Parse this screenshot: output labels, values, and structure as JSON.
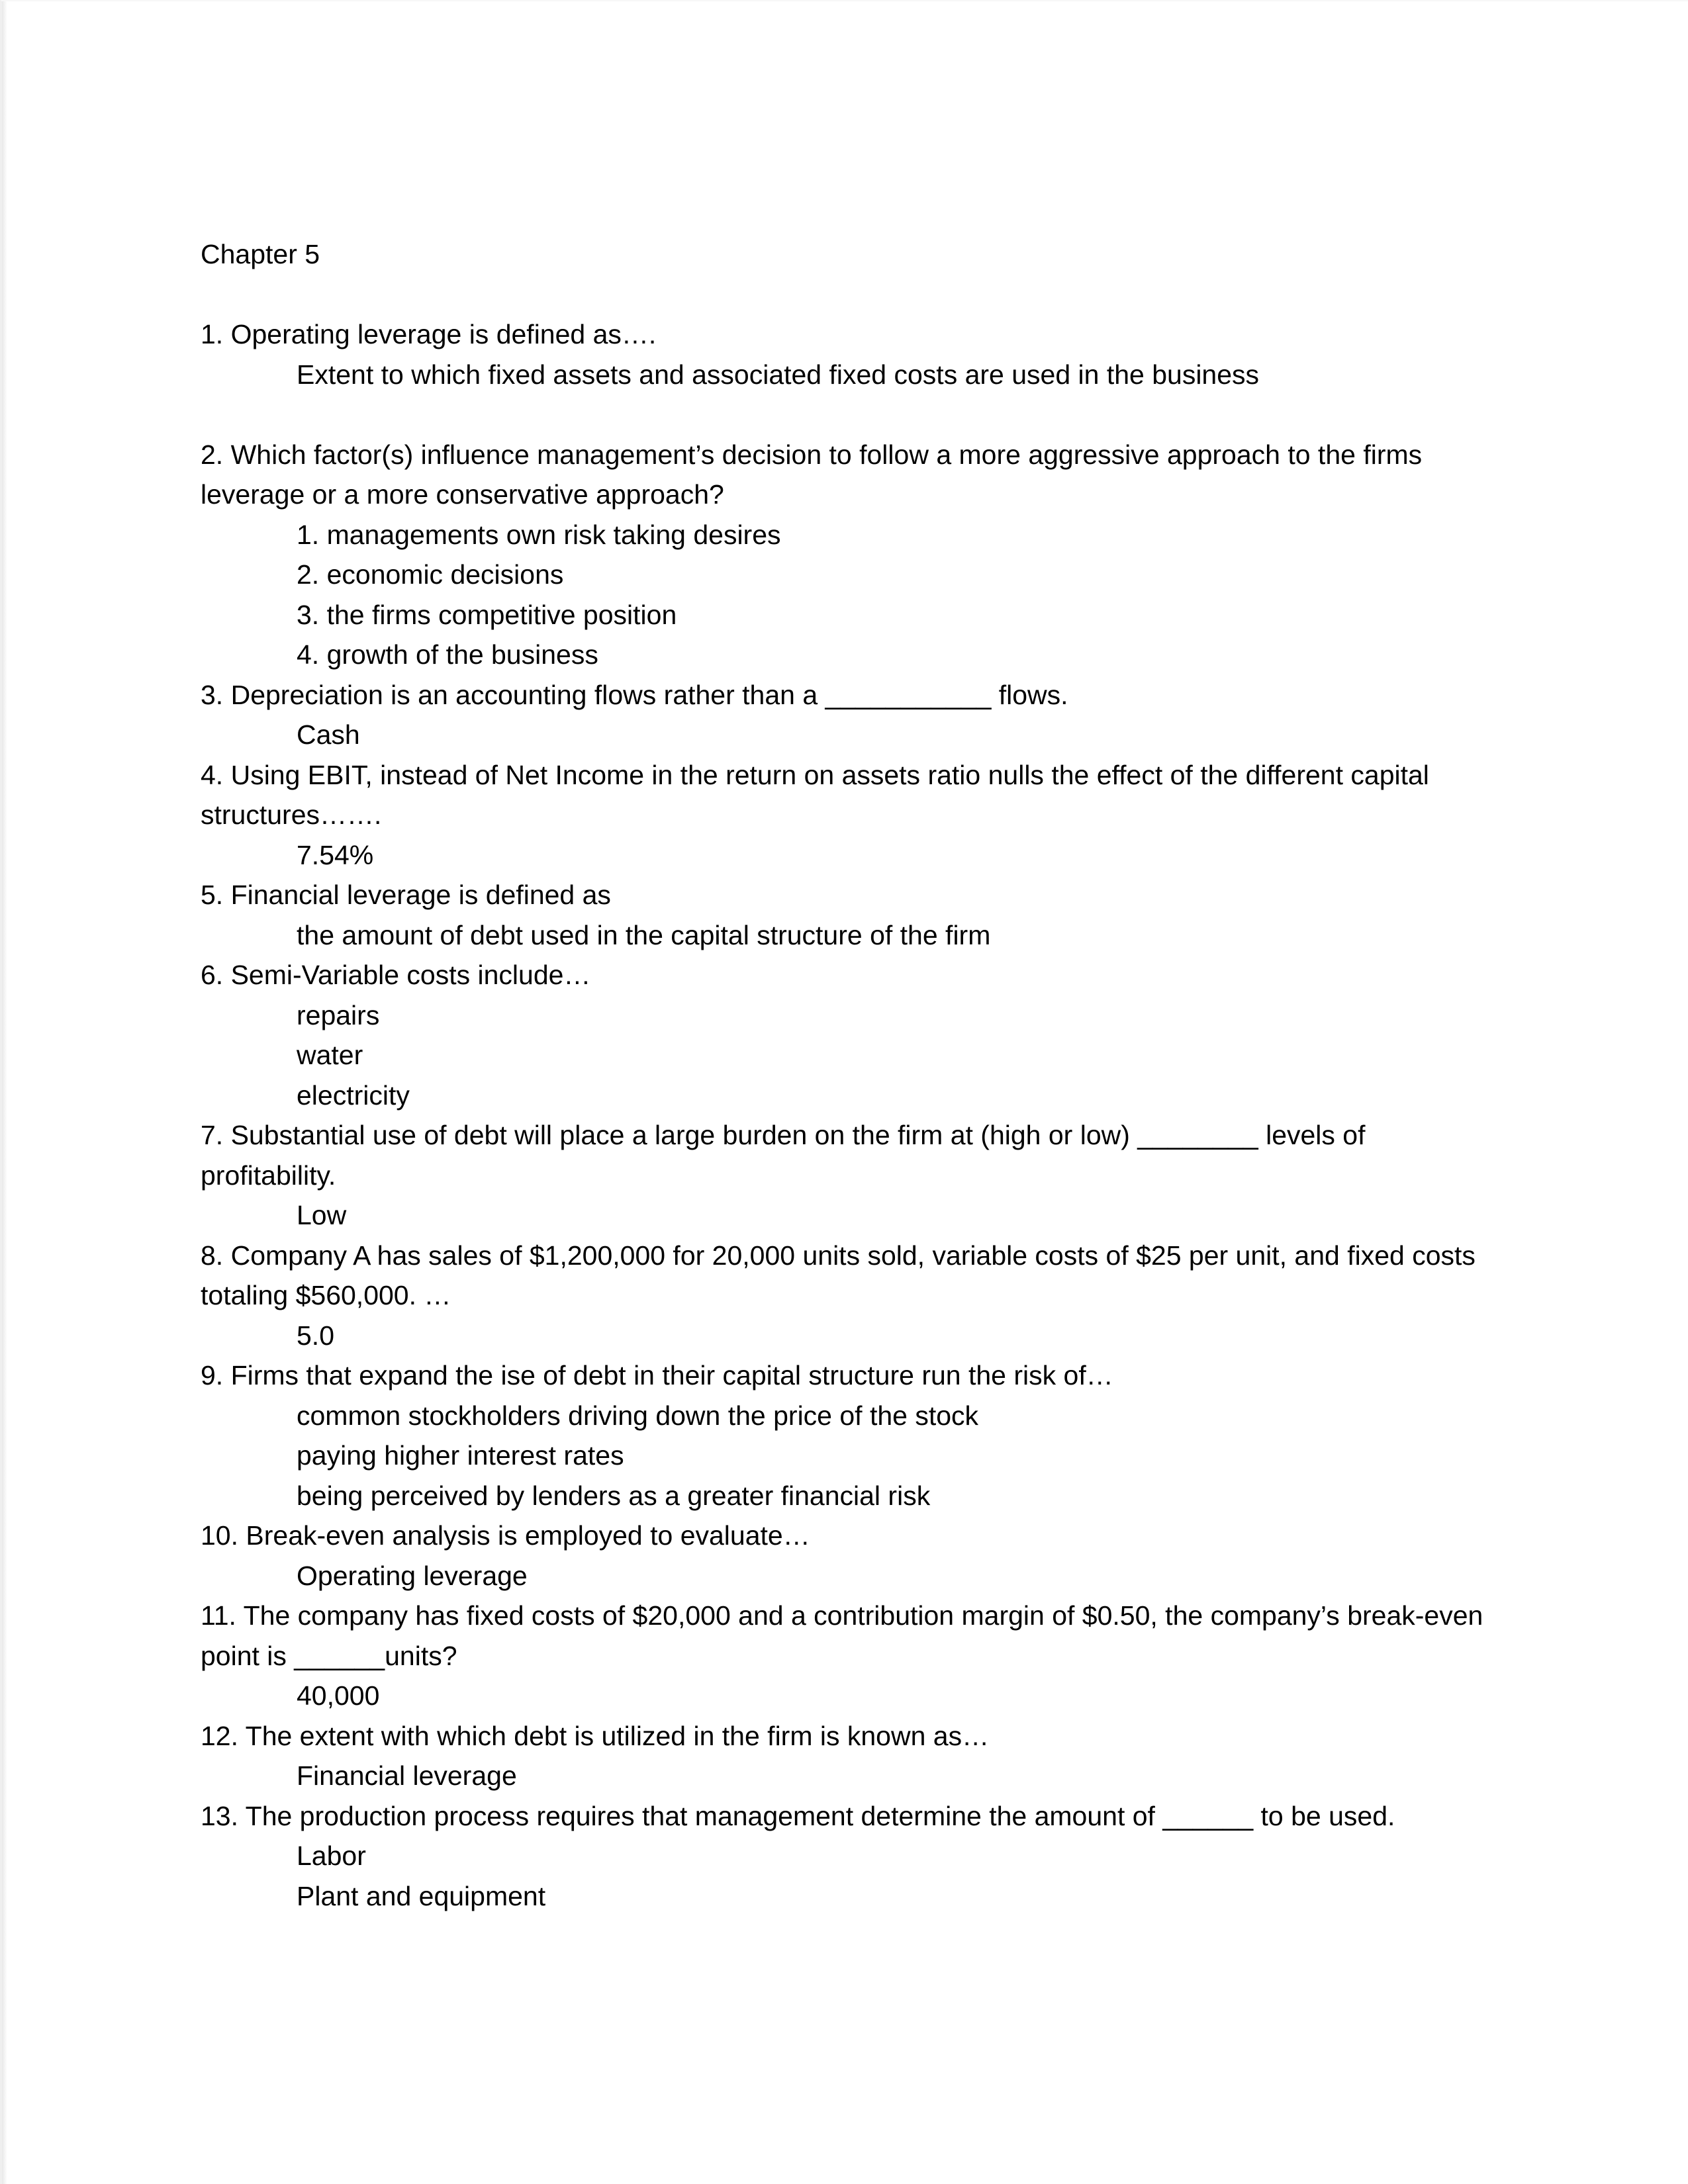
{
  "document": {
    "title": "Chapter 5",
    "blocks": [
      {
        "type": "heading",
        "indent": 0,
        "text": "Chapter 5"
      },
      {
        "type": "spacer",
        "indent": 0,
        "text": ""
      },
      {
        "type": "question",
        "indent": 0,
        "text": "1. Operating leverage is defined as…."
      },
      {
        "type": "answer",
        "indent": 1,
        "text": "Extent to which fixed assets and associated fixed costs are used in the business"
      },
      {
        "type": "spacer",
        "indent": 0,
        "text": ""
      },
      {
        "type": "question",
        "indent": 0,
        "text": "2. Which factor(s) influence management’s decision to follow a more aggressive approach to the firms leverage or a more conservative approach?"
      },
      {
        "type": "answer",
        "indent": 2,
        "text": "1. managements own risk taking desires"
      },
      {
        "type": "answer",
        "indent": 2,
        "text": "2. economic decisions"
      },
      {
        "type": "answer",
        "indent": 2,
        "text": "3. the firms competitive position"
      },
      {
        "type": "answer",
        "indent": 2,
        "text": "4. growth of the business"
      },
      {
        "type": "question",
        "indent": 0,
        "text": "3. Depreciation is an accounting flows rather than a ___________ flows."
      },
      {
        "type": "answer",
        "indent": 1,
        "text": "Cash"
      },
      {
        "type": "question",
        "indent": 0,
        "text": "4. Using EBIT, instead of Net Income in the return on assets ratio nulls the effect of the different capital structures……."
      },
      {
        "type": "answer",
        "indent": 1,
        "text": "7.54%"
      },
      {
        "type": "question",
        "indent": 0,
        "text": "5. Financial leverage is defined as"
      },
      {
        "type": "answer",
        "indent": 1,
        "text": "the amount of debt used in the capital structure of the firm"
      },
      {
        "type": "question",
        "indent": 0,
        "text": "6. Semi-Variable costs include…"
      },
      {
        "type": "answer",
        "indent": 1,
        "text": "repairs"
      },
      {
        "type": "answer",
        "indent": 1,
        "text": "water"
      },
      {
        "type": "answer",
        "indent": 1,
        "text": "electricity"
      },
      {
        "type": "question",
        "indent": 0,
        "text": "7. Substantial use of debt will place a large burden on the firm at (high or low) ________ levels of profitability."
      },
      {
        "type": "answer",
        "indent": 1,
        "text": "Low"
      },
      {
        "type": "question",
        "indent": 0,
        "text": "8. Company A has sales of $1,200,000 for 20,000 units sold, variable costs of $25 per unit, and fixed costs totaling $560,000. …"
      },
      {
        "type": "answer",
        "indent": 1,
        "text": "5.0"
      },
      {
        "type": "question",
        "indent": 0,
        "text": "9. Firms that expand the ise of debt in their capital structure run the risk of…"
      },
      {
        "type": "answer",
        "indent": 1,
        "text": "common stockholders driving down the price of the stock"
      },
      {
        "type": "answer",
        "indent": 1,
        "text": "paying higher interest rates"
      },
      {
        "type": "answer",
        "indent": 1,
        "text": "being perceived by lenders as a greater financial risk"
      },
      {
        "type": "question",
        "indent": 0,
        "text": "10. Break-even analysis is employed to evaluate…"
      },
      {
        "type": "answer",
        "indent": 1,
        "text": "Operating leverage"
      },
      {
        "type": "question",
        "indent": 0,
        "text": "11. The company has fixed costs of $20,000 and a contribution margin of $0.50, the company’s break-even point is ______units?"
      },
      {
        "type": "answer",
        "indent": 1,
        "text": "40,000"
      },
      {
        "type": "question",
        "indent": 0,
        "text": "12. The extent with which debt is utilized in the firm is known as…"
      },
      {
        "type": "answer",
        "indent": 1,
        "text": "Financial leverage"
      },
      {
        "type": "question",
        "indent": 0,
        "text": "13. The production process requires that management determine the amount of ______ to be used."
      },
      {
        "type": "answer",
        "indent": 1,
        "text": "Labor"
      },
      {
        "type": "answer",
        "indent": 1,
        "text": "Plant and equipment"
      }
    ]
  }
}
